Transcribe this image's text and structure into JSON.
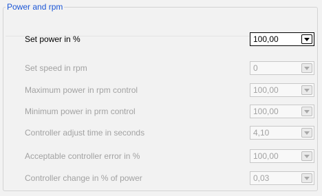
{
  "group": {
    "title": "Power and rpm"
  },
  "rows": [
    {
      "label": "Set power in %",
      "value": "100,00",
      "enabled": true
    },
    {
      "label": "Set speed in rpm",
      "value": "0",
      "enabled": false
    },
    {
      "label": "Maximum power in rpm control",
      "value": "100,00",
      "enabled": false
    },
    {
      "label": "Minimum power in prm control",
      "value": "100,00",
      "enabled": false
    },
    {
      "label": "Controller adjust time in seconds",
      "value": "4,10",
      "enabled": false
    },
    {
      "label": "Acceptable controller error in %",
      "value": "100,00",
      "enabled": false
    },
    {
      "label": "Controller change in % of power",
      "value": "0,03",
      "enabled": false
    }
  ],
  "icons": {
    "dropdown": "chevron-down-icon"
  },
  "colors": {
    "group_title": "#1a55d6",
    "disabled_text": "#a2a2a2"
  }
}
